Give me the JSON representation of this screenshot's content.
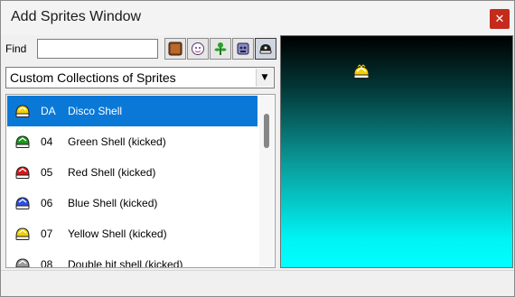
{
  "window": {
    "title": "Add Sprites Window",
    "close_label": "✕"
  },
  "toolbar": {
    "find_label": "Find",
    "find_value": "",
    "buttons": [
      {
        "icon": "brick-block-icon"
      },
      {
        "icon": "boo-ghost-icon"
      },
      {
        "icon": "piranha-plant-icon"
      },
      {
        "icon": "thwomp-icon"
      },
      {
        "icon": "shell-icon"
      }
    ]
  },
  "collection": {
    "selected": "Custom Collections of Sprites"
  },
  "sprite_list": {
    "items": [
      {
        "code": "DA",
        "name": "Disco Shell",
        "icon": "disco-shell-icon",
        "shell_color": "#f4d000",
        "selected": true
      },
      {
        "code": "04",
        "name": "Green Shell (kicked)",
        "icon": "green-shell-icon",
        "shell_color": "#1a9a1a",
        "selected": false
      },
      {
        "code": "05",
        "name": "Red Shell (kicked)",
        "icon": "red-shell-icon",
        "shell_color": "#d81818",
        "selected": false
      },
      {
        "code": "06",
        "name": "Blue Shell (kicked)",
        "icon": "blue-shell-icon",
        "shell_color": "#3050e0",
        "selected": false
      },
      {
        "code": "07",
        "name": "Yellow Shell (kicked)",
        "icon": "yellow-shell-icon",
        "shell_color": "#f0d000",
        "selected": false
      },
      {
        "code": "08",
        "name": "Double hit shell (kicked)",
        "icon": "gray-shell-icon",
        "shell_color": "#9a9a9a",
        "selected": false
      }
    ]
  },
  "preview": {
    "sprite_icon": "disco-shell-icon"
  },
  "colors": {
    "selection": "#0a78d7",
    "close_button": "#c42b1c",
    "preview_gradient_top": "#000000",
    "preview_gradient_bottom": "#00ffff"
  }
}
